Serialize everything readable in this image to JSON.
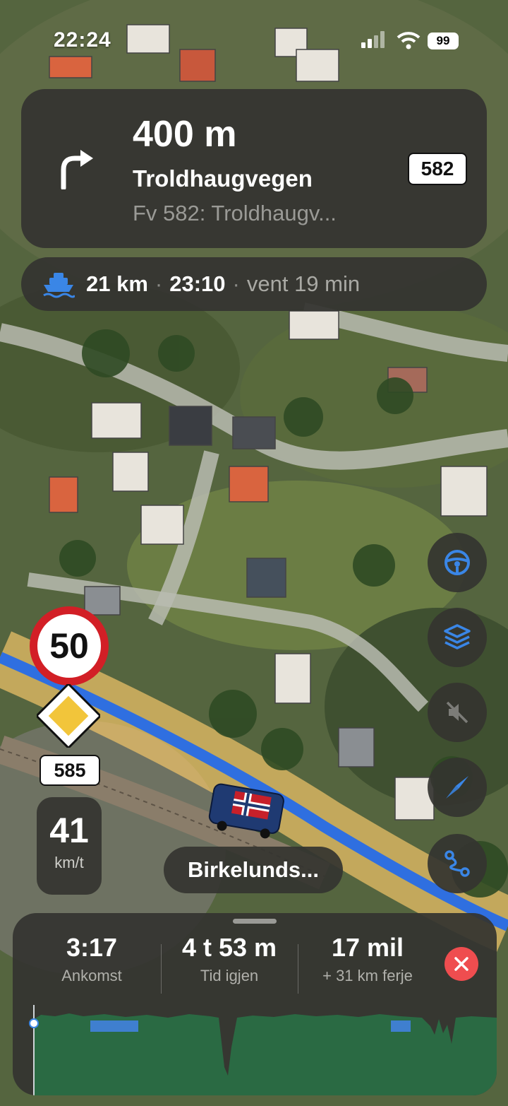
{
  "status_bar": {
    "time": "22:24",
    "battery": "99"
  },
  "navigation": {
    "distance": "400 m",
    "street": "Troldhaugvegen",
    "substreet": "Fv 582: Troldhaugv...",
    "road_number": "582",
    "turn_icon": "turn-right-icon"
  },
  "ferry": {
    "icon": "ferry-icon",
    "distance": "21 km",
    "separator": "·",
    "departure": "23:10",
    "wait": "vent 19 min"
  },
  "speed": {
    "limit": "50",
    "road_number": "585",
    "current": "41",
    "unit": "km/t"
  },
  "side_buttons": [
    "steering-wheel-icon",
    "layers-icon",
    "mute-icon",
    "compass-icon",
    "route-icon"
  ],
  "road_label": "Birkelunds...",
  "trip": {
    "arrival": {
      "value": "3:17",
      "label": "Ankomst"
    },
    "remaining": {
      "value": "4 t 53 m",
      "label": "Tid igjen"
    },
    "distance": {
      "value": "17 mil",
      "label": "+ 31 km ferje"
    }
  },
  "colors": {
    "accent": "#3a86e6",
    "route": "#2f6fe0",
    "speed_sign_red": "#d21f26",
    "close_red": "#ef4d4f",
    "profile_green": "#2a6a43",
    "ferry_segment": "#3f7fcf"
  }
}
